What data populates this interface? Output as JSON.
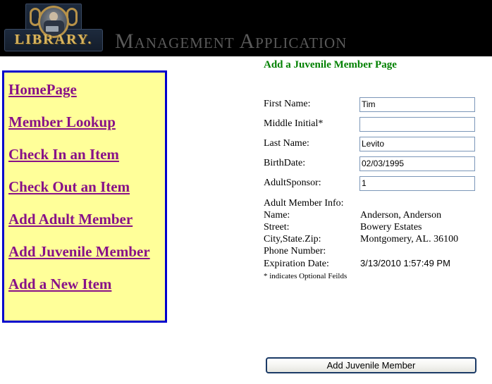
{
  "header": {
    "logo_word": "LIBRARY.",
    "logo_alt": "library-plaque-logo",
    "app_title": "Management Application"
  },
  "sidebar": {
    "links": [
      {
        "label": "HomePage",
        "name": "nav-homepage"
      },
      {
        "label": "Member Lookup",
        "name": "nav-member-lookup"
      },
      {
        "label": "Check In an Item",
        "name": "nav-check-in-item"
      },
      {
        "label": "Check Out an Item",
        "name": "nav-check-out-item"
      },
      {
        "label": "Add Adult Member",
        "name": "nav-add-adult-member"
      },
      {
        "label": "Add Juvenile Member",
        "name": "nav-add-juvenile-member"
      },
      {
        "label": "Add a New Item",
        "name": "nav-add-new-item"
      }
    ]
  },
  "main": {
    "heading": "Add a Juvenile Member Page",
    "fields": [
      {
        "label": "First Name:",
        "value": "Tim",
        "placeholder": ""
      },
      {
        "label": "Middle Initial*",
        "value": "",
        "placeholder": ""
      },
      {
        "label": "Last Name:",
        "value": "Levito",
        "placeholder": ""
      },
      {
        "label": "BirthDate:",
        "value": "02/03/1995",
        "placeholder": ""
      },
      {
        "label": "AdultSponsor:",
        "value": "1",
        "placeholder": ""
      }
    ],
    "adult_info": {
      "section_label": "Adult Member Info:",
      "rows": [
        {
          "label": "Name:",
          "value": "Anderson, Anderson"
        },
        {
          "label": "Street:",
          "value": "Bowery Estates"
        },
        {
          "label": "City,State.Zip:",
          "value": "Montgomery, AL. 36100"
        },
        {
          "label": "Phone Number:",
          "value": ""
        },
        {
          "label": "Expiration Date:",
          "value": "3/13/2010 1:57:49 PM"
        }
      ]
    },
    "optional_note": "* indicates Optional Feilds",
    "submit_label": "Add Juvenile Member"
  },
  "colors": {
    "header_bg": "#000000",
    "app_title": "#5a5a5a",
    "sidebar_bg": "#ffff99",
    "sidebar_border": "#0000cc",
    "link": "#881188",
    "heading_green": "#008000",
    "input_border": "#7b96b8",
    "button_border": "#1b3a66",
    "logo_gold": "#d8b45e",
    "logo_navy": "#1d2a3d"
  }
}
